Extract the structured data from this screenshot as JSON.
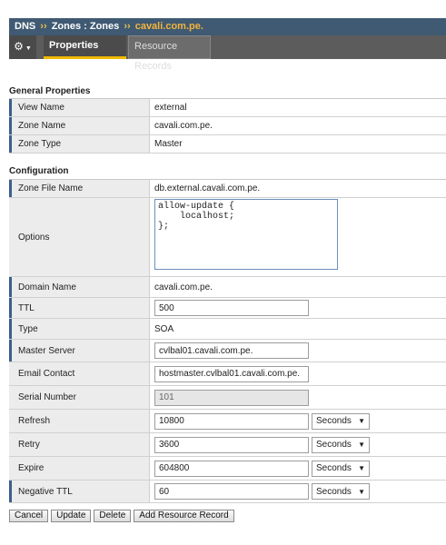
{
  "breadcrumb": {
    "part1": "DNS",
    "sep": "››",
    "part2": "Zones : Zones",
    "current": "cavali.com.pe."
  },
  "tabs": {
    "gear": "⚙",
    "properties": "Properties",
    "resource_records": "Resource Records"
  },
  "general": {
    "title": "General Properties",
    "view_name_label": "View Name",
    "view_name": "external",
    "zone_name_label": "Zone Name",
    "zone_name": "cavali.com.pe.",
    "zone_type_label": "Zone Type",
    "zone_type": "Master"
  },
  "config": {
    "title": "Configuration",
    "zone_file_label": "Zone File Name",
    "zone_file": "db.external.cavali.com.pe.",
    "options_label": "Options",
    "options_value": "allow-update {\n    localhost;\n};\n",
    "domain_label": "Domain Name",
    "domain": "cavali.com.pe.",
    "ttl_label": "TTL",
    "ttl": "500",
    "type_label": "Type",
    "type": "SOA",
    "master_label": "Master Server",
    "master": "cvlbal01.cavali.com.pe.",
    "email_label": "Email Contact",
    "email": "hostmaster.cvlbal01.cavali.com.pe.",
    "serial_label": "Serial Number",
    "serial": "101",
    "refresh_label": "Refresh",
    "refresh": "10800",
    "refresh_unit": "Seconds",
    "retry_label": "Retry",
    "retry": "3600",
    "retry_unit": "Seconds",
    "expire_label": "Expire",
    "expire": "604800",
    "expire_unit": "Seconds",
    "neg_ttl_label": "Negative TTL",
    "neg_ttl": "60",
    "neg_ttl_unit": "Seconds"
  },
  "actions": {
    "cancel": "Cancel",
    "update": "Update",
    "delete": "Delete",
    "add_record": "Add Resource Record"
  }
}
